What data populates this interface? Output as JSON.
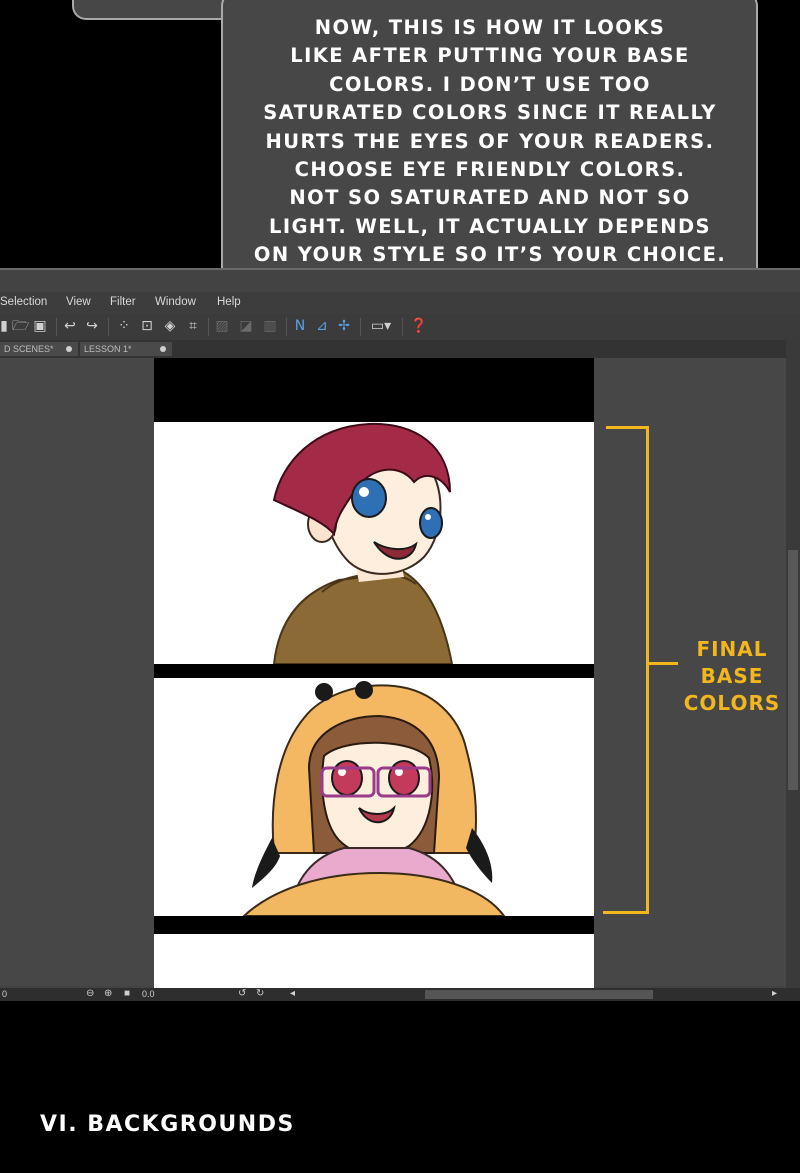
{
  "bubble": {
    "lines": [
      "NOW, THIS IS HOW IT LOOKS",
      "LIKE AFTER PUTTING YOUR BASE",
      "COLORS. I DON’T USE TOO",
      "SATURATED COLORS SINCE IT REALLY",
      "HURTS THE EYES OF YOUR READERS.",
      "CHOOSE EYE FRIENDLY COLORS.",
      "NOT SO SATURATED AND NOT SO",
      "LIGHT. WELL, IT ACTUALLY DEPENDS",
      "ON YOUR STYLE SO IT’S YOUR CHOICE."
    ]
  },
  "menu": [
    "Selection",
    "View",
    "Filter",
    "Window",
    "Help"
  ],
  "tabs": [
    {
      "label": "D SCENES*"
    },
    {
      "label": "LESSON 1*"
    }
  ],
  "status": {
    "left_value": "0",
    "zoom_value": "0.0"
  },
  "annotation": [
    "FINAL",
    "BASE",
    "COLORS"
  ],
  "section_heading": "VI. BACKGROUNDS",
  "colors": {
    "annotation": "#f2b61e",
    "bubble_fill": "#474747",
    "bubble_border": "#a9a9a9",
    "app_bg": "#434343"
  }
}
